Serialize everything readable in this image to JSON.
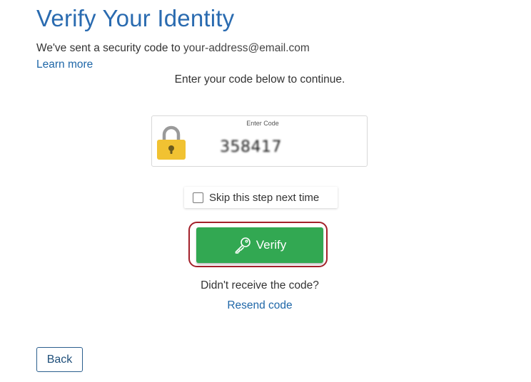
{
  "header": {
    "title": "Verify Your Identity",
    "sent_prefix": "We've sent a security code to ",
    "email": "your-address@email.com",
    "learn_more": "Learn more"
  },
  "instruction": "Enter your code below to continue.",
  "code": {
    "label": "Enter Code",
    "value": "358417",
    "icon": "padlock-icon"
  },
  "skip": {
    "label": "Skip this step next time",
    "checked": false
  },
  "verify": {
    "label": "Verify",
    "icon": "key-icon",
    "color": "#32a852",
    "highlight_color": "#a3202a"
  },
  "resend": {
    "prompt": "Didn't receive the code?",
    "link": "Resend code"
  },
  "back": {
    "label": "Back"
  },
  "colors": {
    "title": "#2a6bb0",
    "link": "#1f67a8"
  }
}
